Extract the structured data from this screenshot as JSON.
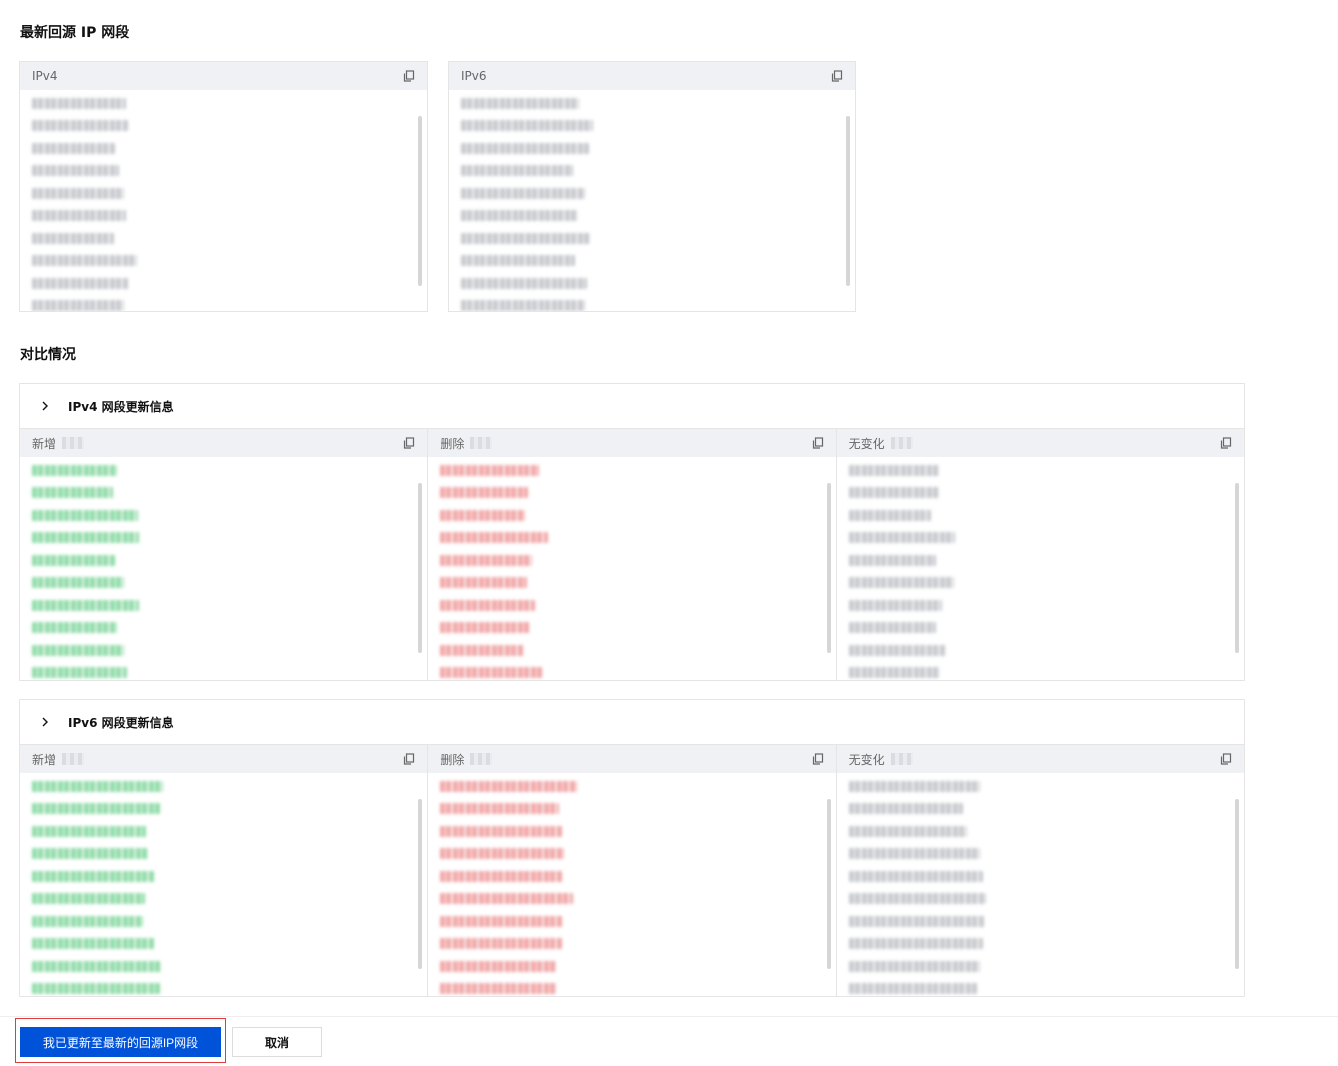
{
  "latest_title": "最新回源 IP 网段",
  "ipv4_panel": {
    "label": "IPv4"
  },
  "ipv6_panel": {
    "label": "IPv6"
  },
  "compare_title": "对比情况",
  "ipv4_update": {
    "title": "IPv4 网段更新信息",
    "columns": [
      {
        "label": "新增",
        "tone": "green"
      },
      {
        "label": "删除",
        "tone": "red"
      },
      {
        "label": "无变化",
        "tone": "gray"
      }
    ]
  },
  "ipv6_update": {
    "title": "IPv6 网段更新信息",
    "columns": [
      {
        "label": "新增",
        "tone": "green"
      },
      {
        "label": "删除",
        "tone": "red"
      },
      {
        "label": "无变化",
        "tone": "gray"
      }
    ]
  },
  "actions": {
    "confirm_label": "我已更新至最新的回源IP网段",
    "cancel_label": "取消"
  },
  "colors": {
    "primary": "#0052d9",
    "highlight_border": "#e03c3c",
    "green": "#8fdca8",
    "red": "#f2a6a6",
    "gray": "#c7c9ce"
  }
}
